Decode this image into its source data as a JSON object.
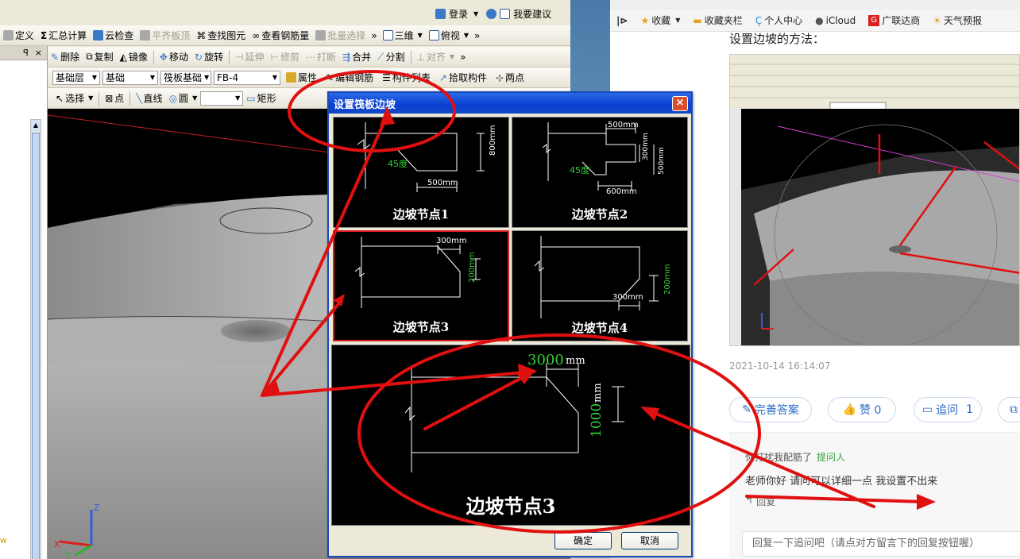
{
  "cad": {
    "top_links": {
      "login": "登录",
      "suggest": "我要建议"
    },
    "toolbar1": [
      "定义",
      "汇总计算",
      "云检查",
      "平齐板顶",
      "查找图元",
      "查看钢筋量",
      "批量选择"
    ],
    "toolbar1_right": {
      "view3d": "三维",
      "topview": "俯视"
    },
    "toolbar2": [
      "删除",
      "复制",
      "镜像",
      "移动",
      "旋转",
      "延伸",
      "修剪",
      "打断",
      "合并",
      "分割",
      "对齐"
    ],
    "toolbar3": {
      "layer": "基础层",
      "category": "基础",
      "component_type": "筏板基础",
      "component": "FB-4",
      "attr": "属性",
      "edit_rebar": "编辑钢筋",
      "comp_list": "构件列表",
      "pick": "拾取构件",
      "two_points": "两点"
    },
    "toolbar4": {
      "select": "选择",
      "point": "点",
      "line": "直线",
      "circle": "圆",
      "rect": "矩形"
    },
    "left_strip_pin": "ꟼ",
    "left_strip_close": "×",
    "axis_z": "Z",
    "axis_x": "X",
    "axis_y": "Y",
    "stray_w": "w"
  },
  "dialog": {
    "title": "设置筏板边坡",
    "close": "×",
    "tiles": [
      {
        "label": "边坡节点1",
        "dims": [
          "45度",
          "500mm",
          "800mm"
        ]
      },
      {
        "label": "边坡节点2",
        "dims": [
          "500mm",
          "45度",
          "600mm",
          "300mm",
          "500mm"
        ]
      },
      {
        "label": "边坡节点3",
        "dims": [
          "300mm",
          "200mm"
        ]
      },
      {
        "label": "边坡节点4",
        "dims": [
          "300mm",
          "200mm"
        ]
      }
    ],
    "preview": {
      "label": "边坡节点3",
      "width_value": "3000",
      "height_value": "1000",
      "unit": "mm"
    },
    "ok": "确定",
    "cancel": "取消"
  },
  "browser": {
    "bookmarks": [
      "收藏",
      "收藏夹栏",
      "个人中心",
      "iCloud",
      "广联达商",
      "天气预报"
    ],
    "heading": "设置边坡的方法：",
    "timestamp": "2021-10-14 16:14:07",
    "actions": {
      "answer": "完善答案",
      "like": "赞 0",
      "ask": "追问",
      "ask_count": "1"
    },
    "comment": {
      "user": "你打扰我配筋了",
      "role": "提问人",
      "text": "老师你好 请问可以详细一点 我设置不出来",
      "reply": "回复"
    },
    "reply_placeholder": "回复一下追问吧（请点对方留言下的回复按钮喔）"
  },
  "colors": {
    "annotation": "#e01010",
    "dim_green": "#36d036",
    "link_blue": "#2a6cc8",
    "dialog_title": "#0a3ed0"
  }
}
